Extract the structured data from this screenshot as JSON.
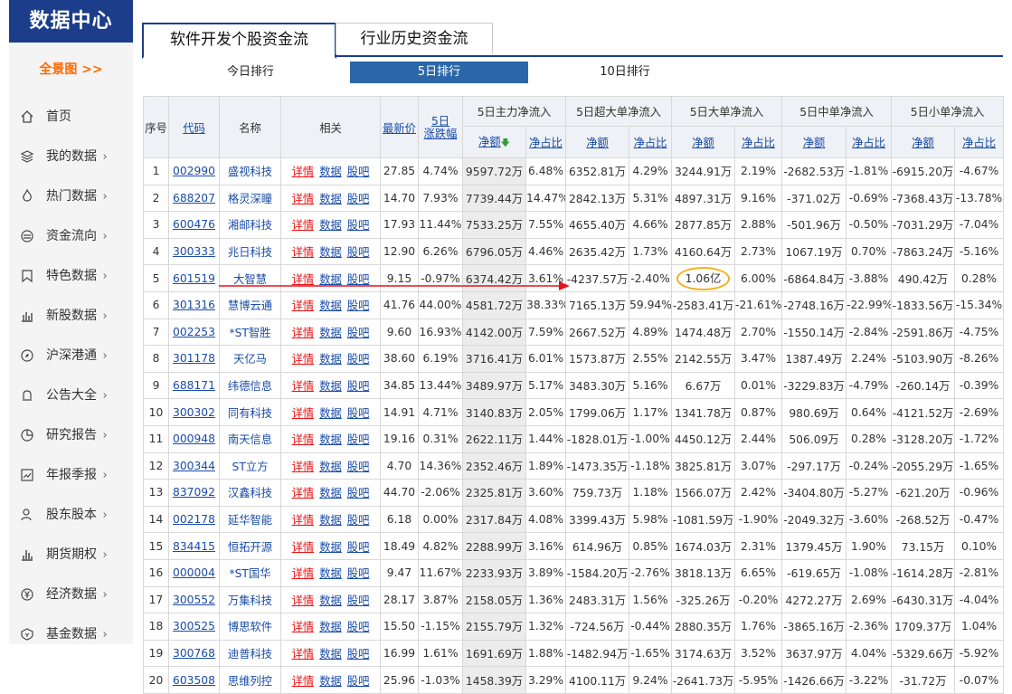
{
  "sidebar": {
    "title": "数据中心",
    "overview": "全景图 >>",
    "items": [
      {
        "label": "首页",
        "icon": "home-icon",
        "arrow": ""
      },
      {
        "label": "我的数据",
        "icon": "layers-icon",
        "arrow": "›"
      },
      {
        "label": "热门数据",
        "icon": "fire-icon",
        "arrow": "›"
      },
      {
        "label": "资金流向",
        "icon": "money-flow-icon",
        "arrow": "›"
      },
      {
        "label": "特色数据",
        "icon": "bookmark-icon",
        "arrow": "›"
      },
      {
        "label": "新股数据",
        "icon": "bar-icon",
        "arrow": "›"
      },
      {
        "label": "沪深港通",
        "icon": "compass-icon",
        "arrow": "›"
      },
      {
        "label": "公告大全",
        "icon": "bell-icon",
        "arrow": "›"
      },
      {
        "label": "研究报告",
        "icon": "pie-icon",
        "arrow": "›"
      },
      {
        "label": "年报季报",
        "icon": "chart-frame-icon",
        "arrow": "›"
      },
      {
        "label": "股东股本",
        "icon": "user-icon",
        "arrow": "›"
      },
      {
        "label": "期货期权",
        "icon": "bars-icon",
        "arrow": "›"
      },
      {
        "label": "经济数据",
        "icon": "yen-icon",
        "arrow": "›"
      },
      {
        "label": "基金数据",
        "icon": "shield-icon",
        "arrow": "›"
      }
    ]
  },
  "tabs": [
    {
      "label": "软件开发个股资金流",
      "active": true
    },
    {
      "label": "行业历史资金流",
      "active": false
    }
  ],
  "subtabs": [
    {
      "label": "今日排行",
      "active": false
    },
    {
      "label": "5日排行",
      "active": true
    },
    {
      "label": "10日排行",
      "active": false
    }
  ],
  "table": {
    "head1": {
      "seq": "序号",
      "code": "代码",
      "name": "名称",
      "rel": "相关",
      "price": "最新价",
      "chg_l1": "5日",
      "chg_l2": "涨跌幅",
      "g1": "5日主力净流入",
      "g2": "5日超大单净流入",
      "g3": "5日大单净流入",
      "g4": "5日中单净流入",
      "g5": "5日小单净流入"
    },
    "head2": {
      "amount": "净额",
      "ratio": "净占比"
    },
    "related_links": [
      "详情",
      "数据",
      "股吧"
    ],
    "rows": [
      [
        "1",
        "002990",
        "盛视科技",
        "27.85",
        "4.74%",
        "9597.72万",
        "6.48%",
        "6352.81万",
        "4.29%",
        "3244.91万",
        "2.19%",
        "-2682.53万",
        "-1.81%",
        "-6915.20万",
        "-4.67%"
      ],
      [
        "2",
        "688207",
        "格灵深瞳",
        "14.70",
        "7.93%",
        "7739.44万",
        "14.47%",
        "2842.13万",
        "5.31%",
        "4897.31万",
        "9.16%",
        "-371.02万",
        "-0.69%",
        "-7368.43万",
        "-13.78%"
      ],
      [
        "3",
        "600476",
        "湘邮科技",
        "17.93",
        "11.44%",
        "7533.25万",
        "7.55%",
        "4655.40万",
        "4.66%",
        "2877.85万",
        "2.88%",
        "-501.96万",
        "-0.50%",
        "-7031.29万",
        "-7.04%"
      ],
      [
        "4",
        "300333",
        "兆日科技",
        "12.90",
        "6.26%",
        "6796.05万",
        "4.46%",
        "2635.42万",
        "1.73%",
        "4160.64万",
        "2.73%",
        "1067.19万",
        "0.70%",
        "-7863.24万",
        "-5.16%"
      ],
      [
        "5",
        "601519",
        "大智慧",
        "9.15",
        "-0.97%",
        "6374.42万",
        "3.61%",
        "-4237.57万",
        "-2.40%",
        "1.06亿",
        "6.00%",
        "-6864.84万",
        "-3.88%",
        "490.42万",
        "0.28%"
      ],
      [
        "6",
        "301316",
        "慧博云通",
        "41.76",
        "44.00%",
        "4581.72万",
        "38.33%",
        "7165.13万",
        "59.94%",
        "-2583.41万",
        "-21.61%",
        "-2748.16万",
        "-22.99%",
        "-1833.56万",
        "-15.34%"
      ],
      [
        "7",
        "002253",
        "*ST智胜",
        "9.60",
        "16.93%",
        "4142.00万",
        "7.59%",
        "2667.52万",
        "4.89%",
        "1474.48万",
        "2.70%",
        "-1550.14万",
        "-2.84%",
        "-2591.86万",
        "-4.75%"
      ],
      [
        "8",
        "301178",
        "天亿马",
        "38.60",
        "6.19%",
        "3716.41万",
        "6.01%",
        "1573.87万",
        "2.55%",
        "2142.55万",
        "3.47%",
        "1387.49万",
        "2.24%",
        "-5103.90万",
        "-8.26%"
      ],
      [
        "9",
        "688171",
        "纬德信息",
        "34.85",
        "13.44%",
        "3489.97万",
        "5.17%",
        "3483.30万",
        "5.16%",
        "6.67万",
        "0.01%",
        "-3229.83万",
        "-4.79%",
        "-260.14万",
        "-0.39%"
      ],
      [
        "10",
        "300302",
        "同有科技",
        "14.91",
        "4.71%",
        "3140.83万",
        "2.05%",
        "1799.06万",
        "1.17%",
        "1341.78万",
        "0.87%",
        "980.69万",
        "0.64%",
        "-4121.52万",
        "-2.69%"
      ],
      [
        "11",
        "000948",
        "南天信息",
        "19.16",
        "0.31%",
        "2622.11万",
        "1.44%",
        "-1828.01万",
        "-1.00%",
        "4450.12万",
        "2.44%",
        "506.09万",
        "0.28%",
        "-3128.20万",
        "-1.72%"
      ],
      [
        "12",
        "300344",
        "ST立方",
        "4.70",
        "14.36%",
        "2352.46万",
        "1.89%",
        "-1473.35万",
        "-1.18%",
        "3825.81万",
        "3.07%",
        "-297.17万",
        "-0.24%",
        "-2055.29万",
        "-1.65%"
      ],
      [
        "13",
        "837092",
        "汉鑫科技",
        "44.70",
        "-2.06%",
        "2325.81万",
        "3.60%",
        "759.73万",
        "1.18%",
        "1566.07万",
        "2.42%",
        "-3404.80万",
        "-5.27%",
        "-621.20万",
        "-0.96%"
      ],
      [
        "14",
        "002178",
        "延华智能",
        "6.18",
        "0.00%",
        "2317.84万",
        "4.08%",
        "3399.43万",
        "5.98%",
        "-1081.59万",
        "-1.90%",
        "-2049.32万",
        "-3.60%",
        "-268.52万",
        "-0.47%"
      ],
      [
        "15",
        "834415",
        "恒拓开源",
        "18.49",
        "4.82%",
        "2288.99万",
        "3.16%",
        "614.96万",
        "0.85%",
        "1674.03万",
        "2.31%",
        "1379.45万",
        "1.90%",
        "73.15万",
        "0.10%"
      ],
      [
        "16",
        "000004",
        "*ST国华",
        "9.47",
        "11.67%",
        "2233.93万",
        "3.89%",
        "-1584.20万",
        "-2.76%",
        "3818.13万",
        "6.65%",
        "-619.65万",
        "-1.08%",
        "-1614.28万",
        "-2.81%"
      ],
      [
        "17",
        "300552",
        "万集科技",
        "28.17",
        "3.87%",
        "2158.05万",
        "1.36%",
        "2483.31万",
        "1.56%",
        "-325.26万",
        "-0.20%",
        "4272.27万",
        "2.69%",
        "-6430.31万",
        "-4.04%"
      ],
      [
        "18",
        "300525",
        "博思软件",
        "15.50",
        "-1.15%",
        "2155.79万",
        "1.32%",
        "-724.56万",
        "-0.44%",
        "2880.35万",
        "1.76%",
        "-3865.16万",
        "-2.36%",
        "1709.37万",
        "1.04%"
      ],
      [
        "19",
        "300768",
        "迪普科技",
        "16.99",
        "1.61%",
        "1691.69万",
        "1.88%",
        "-1482.94万",
        "-1.65%",
        "3174.63万",
        "3.52%",
        "3637.97万",
        "4.04%",
        "-5329.66万",
        "-5.92%"
      ],
      [
        "20",
        "603508",
        "思维列控",
        "25.96",
        "-1.03%",
        "1458.39万",
        "3.29%",
        "4100.11万",
        "9.24%",
        "-2641.73万",
        "-5.95%",
        "-1426.66万",
        "-3.22%",
        "-31.72万",
        "-0.07%"
      ]
    ]
  },
  "colors": {
    "brand": "#1c3d8a",
    "up": "#e4151b",
    "down": "#109c36",
    "highlight_ring": "#f3b21b",
    "accent": "#ff6a00"
  }
}
